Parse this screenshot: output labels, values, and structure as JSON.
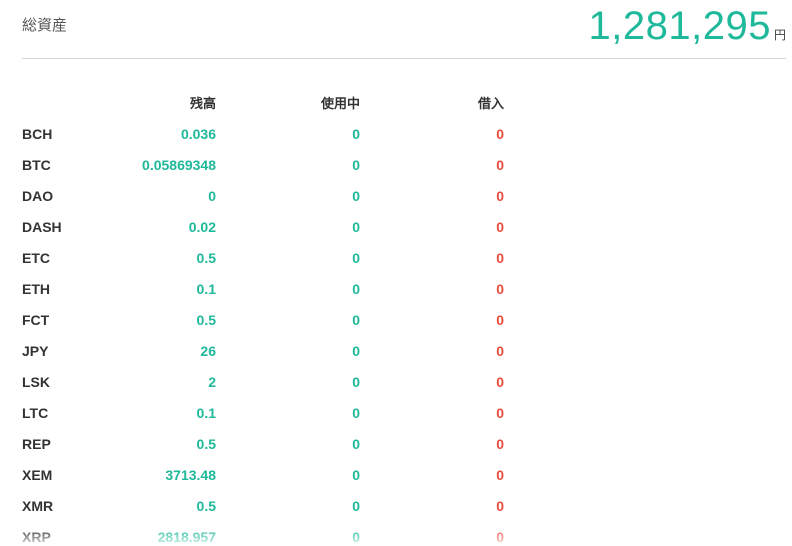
{
  "summary": {
    "label": "総資産",
    "value": "1,281,295",
    "unit": "円"
  },
  "table": {
    "headers": [
      "",
      "残高",
      "使用中",
      "借入"
    ],
    "rows": [
      {
        "symbol": "BCH",
        "balance": "0.036",
        "in_use": "0",
        "borrowed": "0"
      },
      {
        "symbol": "BTC",
        "balance": "0.05869348",
        "in_use": "0",
        "borrowed": "0"
      },
      {
        "symbol": "DAO",
        "balance": "0",
        "in_use": "0",
        "borrowed": "0"
      },
      {
        "symbol": "DASH",
        "balance": "0.02",
        "in_use": "0",
        "borrowed": "0"
      },
      {
        "symbol": "ETC",
        "balance": "0.5",
        "in_use": "0",
        "borrowed": "0"
      },
      {
        "symbol": "ETH",
        "balance": "0.1",
        "in_use": "0",
        "borrowed": "0"
      },
      {
        "symbol": "FCT",
        "balance": "0.5",
        "in_use": "0",
        "borrowed": "0"
      },
      {
        "symbol": "JPY",
        "balance": "26",
        "in_use": "0",
        "borrowed": "0"
      },
      {
        "symbol": "LSK",
        "balance": "2",
        "in_use": "0",
        "borrowed": "0"
      },
      {
        "symbol": "LTC",
        "balance": "0.1",
        "in_use": "0",
        "borrowed": "0"
      },
      {
        "symbol": "REP",
        "balance": "0.5",
        "in_use": "0",
        "borrowed": "0"
      },
      {
        "symbol": "XEM",
        "balance": "3713.48",
        "in_use": "0",
        "borrowed": "0"
      },
      {
        "symbol": "XMR",
        "balance": "0.5",
        "in_use": "0",
        "borrowed": "0"
      },
      {
        "symbol": "XRP",
        "balance": "2818.957",
        "in_use": "0",
        "borrowed": "0"
      }
    ]
  },
  "colors": {
    "positive": "#1eb99a",
    "negative": "#e74c3c",
    "text": "#333333"
  }
}
